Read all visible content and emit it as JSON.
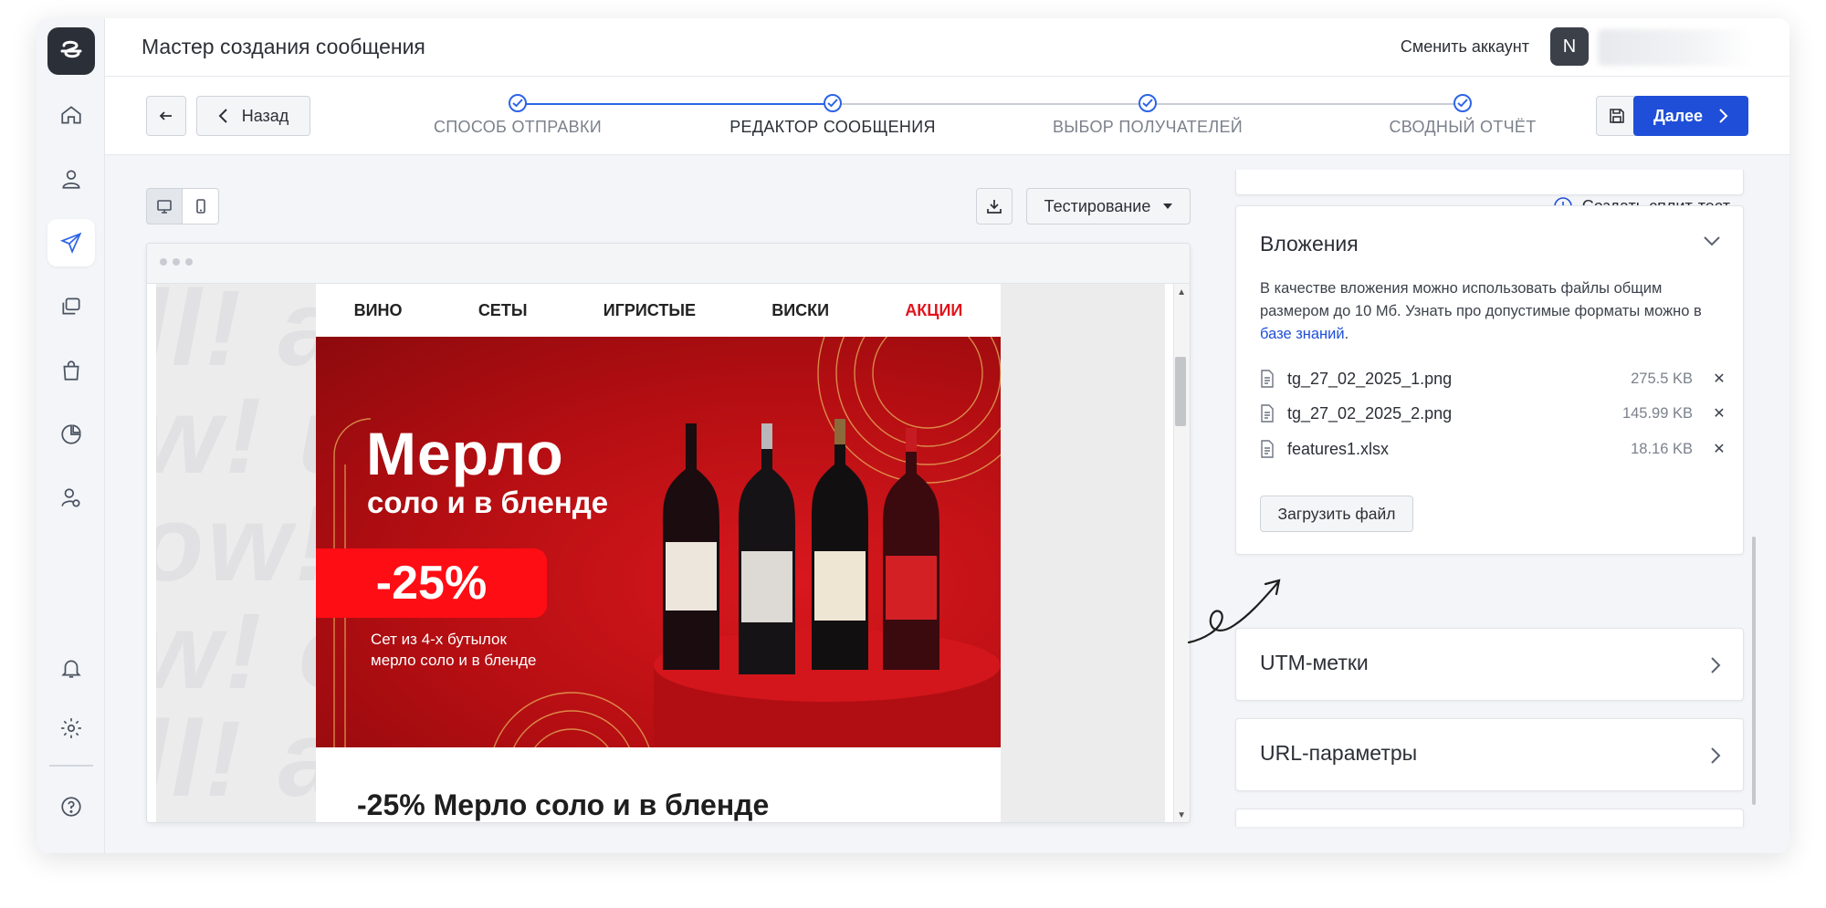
{
  "header": {
    "title": "Мастер создания сообщения",
    "switch_account": "Сменить аккаунт",
    "avatar_letter": "N"
  },
  "wizard": {
    "back_label": "Назад",
    "next_label": "Далее",
    "steps": [
      {
        "label": "СПОСОБ ОТПРАВКИ"
      },
      {
        "label": "РЕДАКТОР СООБЩЕНИЯ"
      },
      {
        "label": "ВЫБОР ПОЛУЧАТЕЛЕЙ"
      },
      {
        "label": "СВОДНЫЙ ОТЧЁТ"
      }
    ]
  },
  "toolbar": {
    "testing_label": "Тестирование",
    "split_test_label": "Создать сплит-тест"
  },
  "email": {
    "menu": [
      "ВИНО",
      "СЕТЫ",
      "ИГРИСТЫЕ",
      "ВИСКИ",
      "АКЦИИ"
    ],
    "banner_title": "Мерло",
    "banner_subtitle": "соло и в бленде",
    "discount": "-25%",
    "banner_note_line1": "Сет из 4-х бутылок",
    "banner_note_line2": "мерло соло и в бленде",
    "heading": "-25% Мерло соло и в бленде",
    "background_text_1": "ll! all! a",
    "background_text_2": "w! ur",
    "background_text_3": "ow! u",
    "background_text_4": "w! o",
    "background_text_5": "ll! a"
  },
  "attachments": {
    "title": "Вложения",
    "desc_part1": "В качестве вложения можно использовать файлы общим размером до 10 Мб. Узнать про допустимые форматы можно в ",
    "desc_link": "базе знаний",
    "desc_end": ".",
    "files": [
      {
        "name": "tg_27_02_2025_1.png",
        "size": "275.5 KB"
      },
      {
        "name": "tg_27_02_2025_2.png",
        "size": "145.99 KB"
      },
      {
        "name": "features1.xlsx",
        "size": "18.16 KB"
      }
    ],
    "upload_label": "Загрузить файл"
  },
  "utm": {
    "title": "UTM-метки"
  },
  "url_params": {
    "title": "URL-параметры"
  },
  "colors": {
    "accent": "#1f4fd8",
    "promo_red": "#e3131b",
    "banner_red": "#c4121a"
  }
}
